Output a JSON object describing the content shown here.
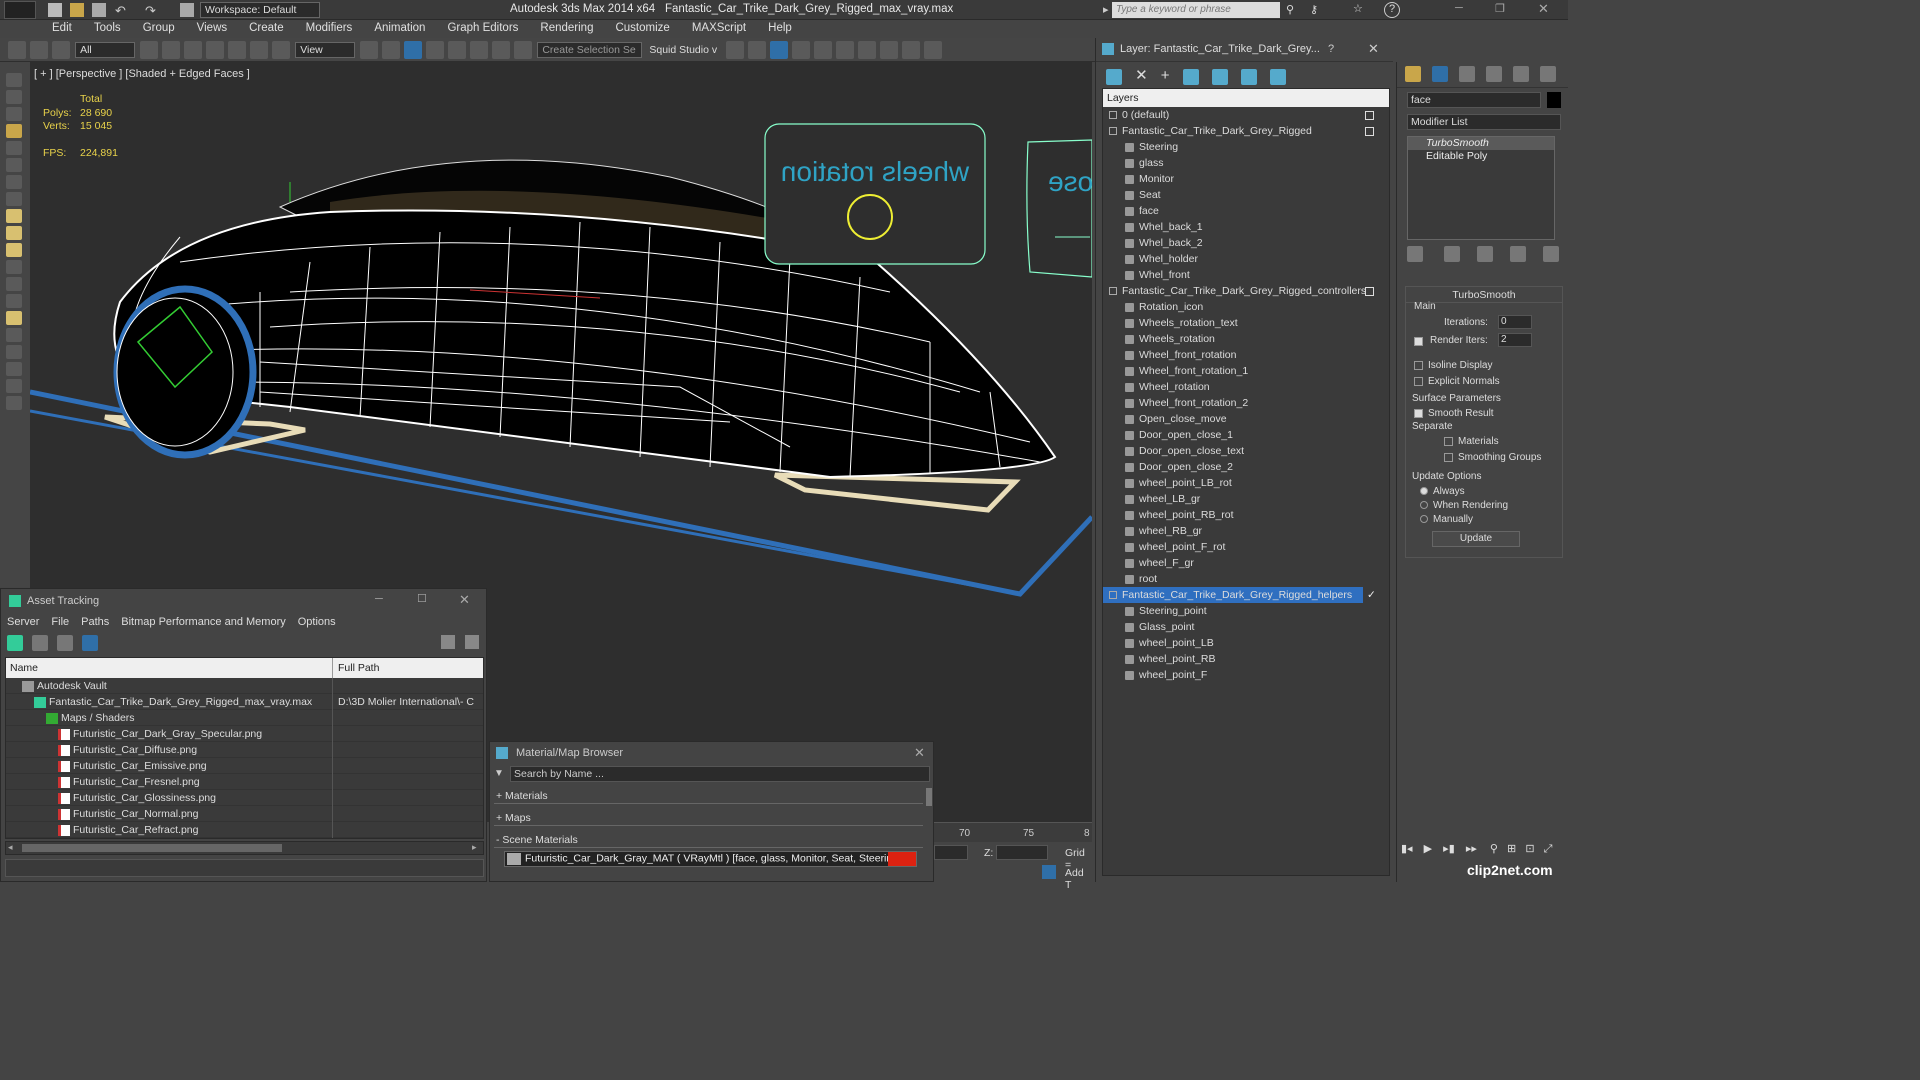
{
  "app": {
    "title": "Autodesk 3ds Max  2014 x64",
    "file": "Fantastic_Car_Trike_Dark_Grey_Rigged_max_vray.max",
    "workspace": "Workspace: Default",
    "search_placeholder": "Type a keyword or phrase"
  },
  "menu": [
    "Edit",
    "Tools",
    "Group",
    "Views",
    "Create",
    "Modifiers",
    "Animation",
    "Graph Editors",
    "Rendering",
    "Customize",
    "MAXScript",
    "Help"
  ],
  "toolbar": {
    "filter": "All",
    "refcoord": "View",
    "selection_set": "Create Selection Se",
    "studio": "Squid Studio v"
  },
  "viewport": {
    "label": "[ + ] [Perspective ] [Shaded + Edged Faces ]",
    "stats_total": "Total",
    "polys_label": "Polys:",
    "polys": "28 690",
    "verts_label": "Verts:",
    "verts": "15 045",
    "fps_label": "FPS:",
    "fps": "224,891",
    "sign_text": "wheels rotation",
    "sign2_text": "ose"
  },
  "layer_panel": {
    "title": "Layer: Fantastic_Car_Trike_Dark_Grey...",
    "help": "?",
    "header": "Layers",
    "rows": [
      {
        "label": "0 (default)",
        "level": 0,
        "kind": "layer",
        "box": true
      },
      {
        "label": "Fantastic_Car_Trike_Dark_Grey_Rigged",
        "level": 0,
        "kind": "layer",
        "box": true
      },
      {
        "label": "Steering",
        "level": 1
      },
      {
        "label": "glass",
        "level": 1
      },
      {
        "label": "Monitor",
        "level": 1
      },
      {
        "label": "Seat",
        "level": 1
      },
      {
        "label": "face",
        "level": 1
      },
      {
        "label": "Whel_back_1",
        "level": 1
      },
      {
        "label": "Whel_back_2",
        "level": 1
      },
      {
        "label": "Whel_holder",
        "level": 1
      },
      {
        "label": "Whel_front",
        "level": 1
      },
      {
        "label": "Fantastic_Car_Trike_Dark_Grey_Rigged_controllers",
        "level": 0,
        "kind": "layer",
        "box": true
      },
      {
        "label": "Rotation_icon",
        "level": 1
      },
      {
        "label": "Wheels_rotation_text",
        "level": 1
      },
      {
        "label": "Wheels_rotation",
        "level": 1
      },
      {
        "label": "Wheel_front_rotation",
        "level": 1
      },
      {
        "label": "Wheel_front_rotation_1",
        "level": 1
      },
      {
        "label": "Wheel_rotation",
        "level": 1
      },
      {
        "label": "Wheel_front_rotation_2",
        "level": 1
      },
      {
        "label": "Open_close_move",
        "level": 1
      },
      {
        "label": "Door_open_close_1",
        "level": 1
      },
      {
        "label": "Door_open_close_text",
        "level": 1
      },
      {
        "label": "Door_open_close_2",
        "level": 1
      },
      {
        "label": "wheel_point_LB_rot",
        "level": 1
      },
      {
        "label": "wheel_LB_gr",
        "level": 1
      },
      {
        "label": "wheel_point_RB_rot",
        "level": 1
      },
      {
        "label": "wheel_RB_gr",
        "level": 1
      },
      {
        "label": "wheel_point_F_rot",
        "level": 1
      },
      {
        "label": "wheel_F_gr",
        "level": 1
      },
      {
        "label": "root",
        "level": 1
      },
      {
        "label": "Fantastic_Car_Trike_Dark_Grey_Rigged_helpers",
        "level": 0,
        "kind": "layer",
        "selected": true,
        "check": true
      },
      {
        "label": "Steering_point",
        "level": 1
      },
      {
        "label": "Glass_point",
        "level": 1
      },
      {
        "label": "wheel_point_LB",
        "level": 1
      },
      {
        "label": "wheel_point_RB",
        "level": 1
      },
      {
        "label": "wheel_point_F",
        "level": 1
      }
    ]
  },
  "cmd_panel": {
    "name": "face",
    "modifier_list": "Modifier List",
    "stack": [
      "TurboSmooth",
      "Editable Poly"
    ],
    "rollout": "TurboSmooth",
    "main": "Main",
    "iterations_label": "Iterations:",
    "iterations": "0",
    "render_iters_label": "Render Iters:",
    "render_iters": "2",
    "isoline": "Isoline Display",
    "explicit": "Explicit Normals",
    "surface": "Surface Parameters",
    "smooth": "Smooth Result",
    "separate": "Separate",
    "materials": "Materials",
    "smoothing": "Smoothing Groups",
    "update_options": "Update Options",
    "always": "Always",
    "when_rendering": "When Rendering",
    "manually": "Manually",
    "update_btn": "Update"
  },
  "asset": {
    "title": "Asset Tracking",
    "menu": [
      "Server",
      "File",
      "Paths",
      "Bitmap Performance and Memory",
      "Options"
    ],
    "col_name": "Name",
    "col_path": "Full Path",
    "rows": [
      {
        "name": "Autodesk Vault",
        "path": "",
        "indent": 1,
        "icon": "vault"
      },
      {
        "name": "Fantastic_Car_Trike_Dark_Grey_Rigged_max_vray.max",
        "path": "D:\\3D Molier International\\- C",
        "indent": 2,
        "icon": "max"
      },
      {
        "name": "Maps / Shaders",
        "path": "",
        "indent": 3,
        "icon": "maps"
      },
      {
        "name": "Futuristic_Car_Dark_Gray_Specular.png",
        "path": "",
        "indent": 4,
        "icon": "png"
      },
      {
        "name": "Futuristic_Car_Diffuse.png",
        "path": "",
        "indent": 4,
        "icon": "png"
      },
      {
        "name": "Futuristic_Car_Emissive.png",
        "path": "",
        "indent": 4,
        "icon": "png"
      },
      {
        "name": "Futuristic_Car_Fresnel.png",
        "path": "",
        "indent": 4,
        "icon": "png"
      },
      {
        "name": "Futuristic_Car_Glossiness.png",
        "path": "",
        "indent": 4,
        "icon": "png"
      },
      {
        "name": "Futuristic_Car_Normal.png",
        "path": "",
        "indent": 4,
        "icon": "png"
      },
      {
        "name": "Futuristic_Car_Refract.png",
        "path": "",
        "indent": 4,
        "icon": "png"
      }
    ]
  },
  "matbrowser": {
    "title": "Material/Map Browser",
    "search": "Search by Name ...",
    "materials": "+ Materials",
    "maps": "+ Maps",
    "scene": "- Scene Materials",
    "item": "Futuristic_Car_Dark_Gray_MAT  ( VRayMtl )  [face, glass, Monitor, Seat, Steering..."
  },
  "timeline": {
    "t70": "70",
    "t75": "75",
    "t80": "8",
    "z_label": "Z:",
    "grid_label": "Grid =",
    "addt": "Add T"
  },
  "watermark": "clip2net.com"
}
